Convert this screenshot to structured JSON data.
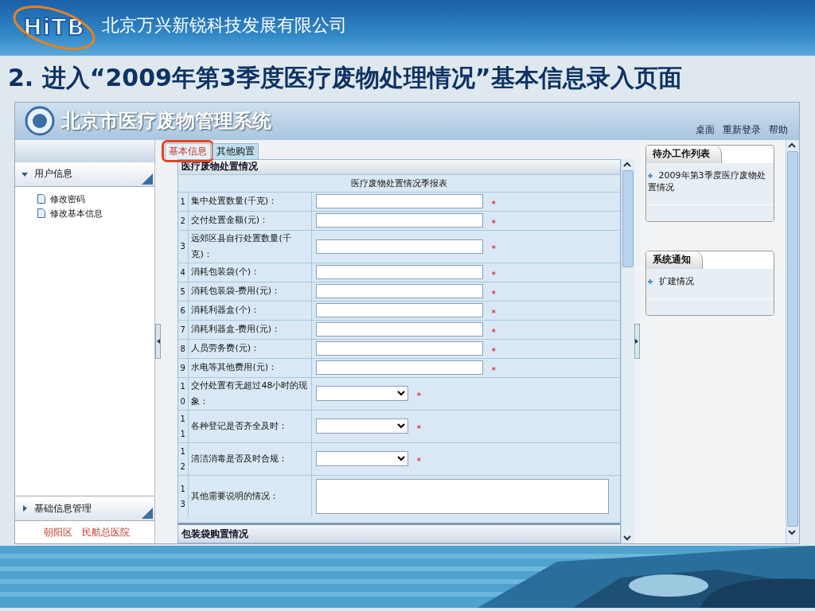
{
  "slide": {
    "logo_text": "HiTB",
    "company": "北京万兴新锐科技发展有限公司",
    "title": "2. 进入“2009年第3季度医疗废物处理情况”基本信息录入页面"
  },
  "app": {
    "title": "北京市医疗废物管理系统",
    "nav": [
      "桌面",
      "重新登录",
      "帮助"
    ]
  },
  "sidebar": {
    "sections": [
      {
        "label": "用户信息",
        "expanded": true,
        "items": [
          "修改密码",
          "修改基本信息"
        ]
      },
      {
        "label": "基础信息管理",
        "expanded": false
      }
    ],
    "footer": [
      "朝阳区",
      "民航总医院"
    ]
  },
  "tabs": [
    {
      "label": "基本信息",
      "selected": true,
      "highlighted": true
    },
    {
      "label": "其他购置",
      "selected": false,
      "highlighted": false
    }
  ],
  "form": {
    "section": "医疗废物处置情况",
    "caption": "医疗废物处置情况季报表",
    "next_section": "包装袋购置情况",
    "rows": [
      {
        "no": "1",
        "label": "集中处置数量(千克)：",
        "kind": "text",
        "mark": "*"
      },
      {
        "no": "2",
        "label": "交付处置金额(元)：",
        "kind": "text",
        "mark": "*"
      },
      {
        "no": "3",
        "label": "远郊区县自行处置数量(千克)：",
        "kind": "text",
        "mark": "*"
      },
      {
        "no": "4",
        "label": "消耗包装袋(个)：",
        "kind": "text",
        "mark": "*"
      },
      {
        "no": "5",
        "label": "消耗包装袋-费用(元)：",
        "kind": "text",
        "mark": "*"
      },
      {
        "no": "6",
        "label": "消耗利器盒(个)：",
        "kind": "text",
        "mark": "*"
      },
      {
        "no": "7",
        "label": "消耗利器盒-费用(元)：",
        "kind": "text",
        "mark": "*"
      },
      {
        "no": "8",
        "label": "人员劳务费(元)：",
        "kind": "text",
        "mark": "*"
      },
      {
        "no": "9",
        "label": "水电等其他费用(元)：",
        "kind": "text",
        "mark": "*"
      },
      {
        "no": "10",
        "label": "交付处置有无超过48小时的现象：",
        "kind": "select",
        "mark": "*"
      },
      {
        "no": "11",
        "label": "各种登记是否齐全及时：",
        "kind": "select",
        "mark": "*"
      },
      {
        "no": "12",
        "label": "清洁消毒是否及时合规：",
        "kind": "select",
        "mark": "*"
      },
      {
        "no": "13",
        "label": "其他需要说明的情况：",
        "kind": "textarea"
      }
    ]
  },
  "panels": [
    {
      "title": "待办工作列表",
      "items": [
        "2009年第3季度医疗废物处置情况"
      ]
    },
    {
      "title": "系统通知",
      "items": [
        "扩建情况"
      ]
    }
  ]
}
